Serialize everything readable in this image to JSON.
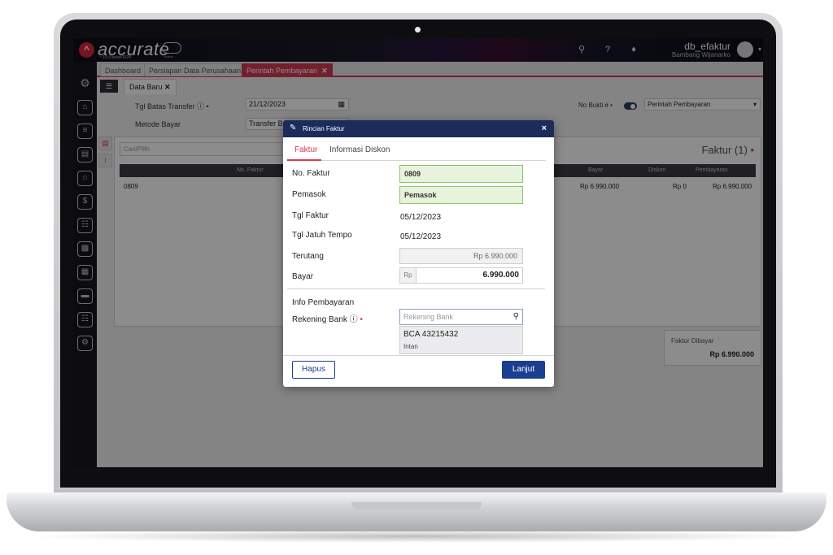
{
  "app": {
    "logo_text": "accurate",
    "logo_sub": "~ 15.0 beta#1624",
    "cloud_sub": "online",
    "user_name": "db_efaktur",
    "user_sub": "Bambang Wijanarko"
  },
  "tabs": [
    {
      "label": "Dashboard"
    },
    {
      "label": "Persiapan Data Perusahaan"
    },
    {
      "label": "Perintah Pembayaran",
      "close": "✕"
    }
  ],
  "subtab": {
    "label": "Data Baru",
    "close": "✕"
  },
  "form": {
    "tgl_batas_label": "Tgl Batas Transfer ⓘ •",
    "tgl_batas_value": "21/12/2023",
    "metode_label": "Metode Bayar",
    "metode_value": "Transfer Bank",
    "no_bukti_label": "No Bukti # •",
    "no_bukti_value": "Perintah Pembayaran"
  },
  "panel": {
    "search_placeholder": "Cari/Pilih",
    "faktur_title": "Faktur (1)",
    "columns": [
      "No. Faktur",
      "Bayar",
      "Diskon",
      "Pembayaran"
    ],
    "row": {
      "no_faktur": "0809",
      "bayar": "Rp 6.990.000",
      "diskon": "Rp 0",
      "pembayaran": "Rp 6.990.000"
    }
  },
  "summary": {
    "label": "Faktur Dibayar",
    "value": "Rp 6.990.000"
  },
  "modal": {
    "title": "Rincian Faktur",
    "close": "×",
    "tabs": [
      "Faktur",
      "Informasi Diskon"
    ],
    "fields": {
      "no_faktur_label": "No. Faktur",
      "no_faktur_value": "0809",
      "pemasok_label": "Pemasok",
      "pemasok_value": "Pemasok",
      "tgl_faktur_label": "Tgl Faktur",
      "tgl_faktur_value": "05/12/2023",
      "tgl_jatuh_tempo_label": "Tgl Jatuh Tempo",
      "tgl_jatuh_tempo_value": "05/12/2023",
      "terutang_label": "Terutang",
      "terutang_value": "Rp 6.990.000",
      "bayar_label": "Bayar",
      "bayar_prefix": "Rp",
      "bayar_value": "6.990.000"
    },
    "info_pembayaran": "Info Pembayaran",
    "rekening_label": "Rekening Bank ⓘ",
    "rekening_placeholder": "Rekening Bank",
    "dropdown": {
      "title": "BCA 43215432",
      "sub": "Intan"
    },
    "buttons": {
      "hapus": "Hapus",
      "lanjut": "Lanjut"
    }
  },
  "colors": {
    "accent": "#d43a52",
    "navy": "#1a2b5c",
    "button_blue": "#1a3f90"
  }
}
